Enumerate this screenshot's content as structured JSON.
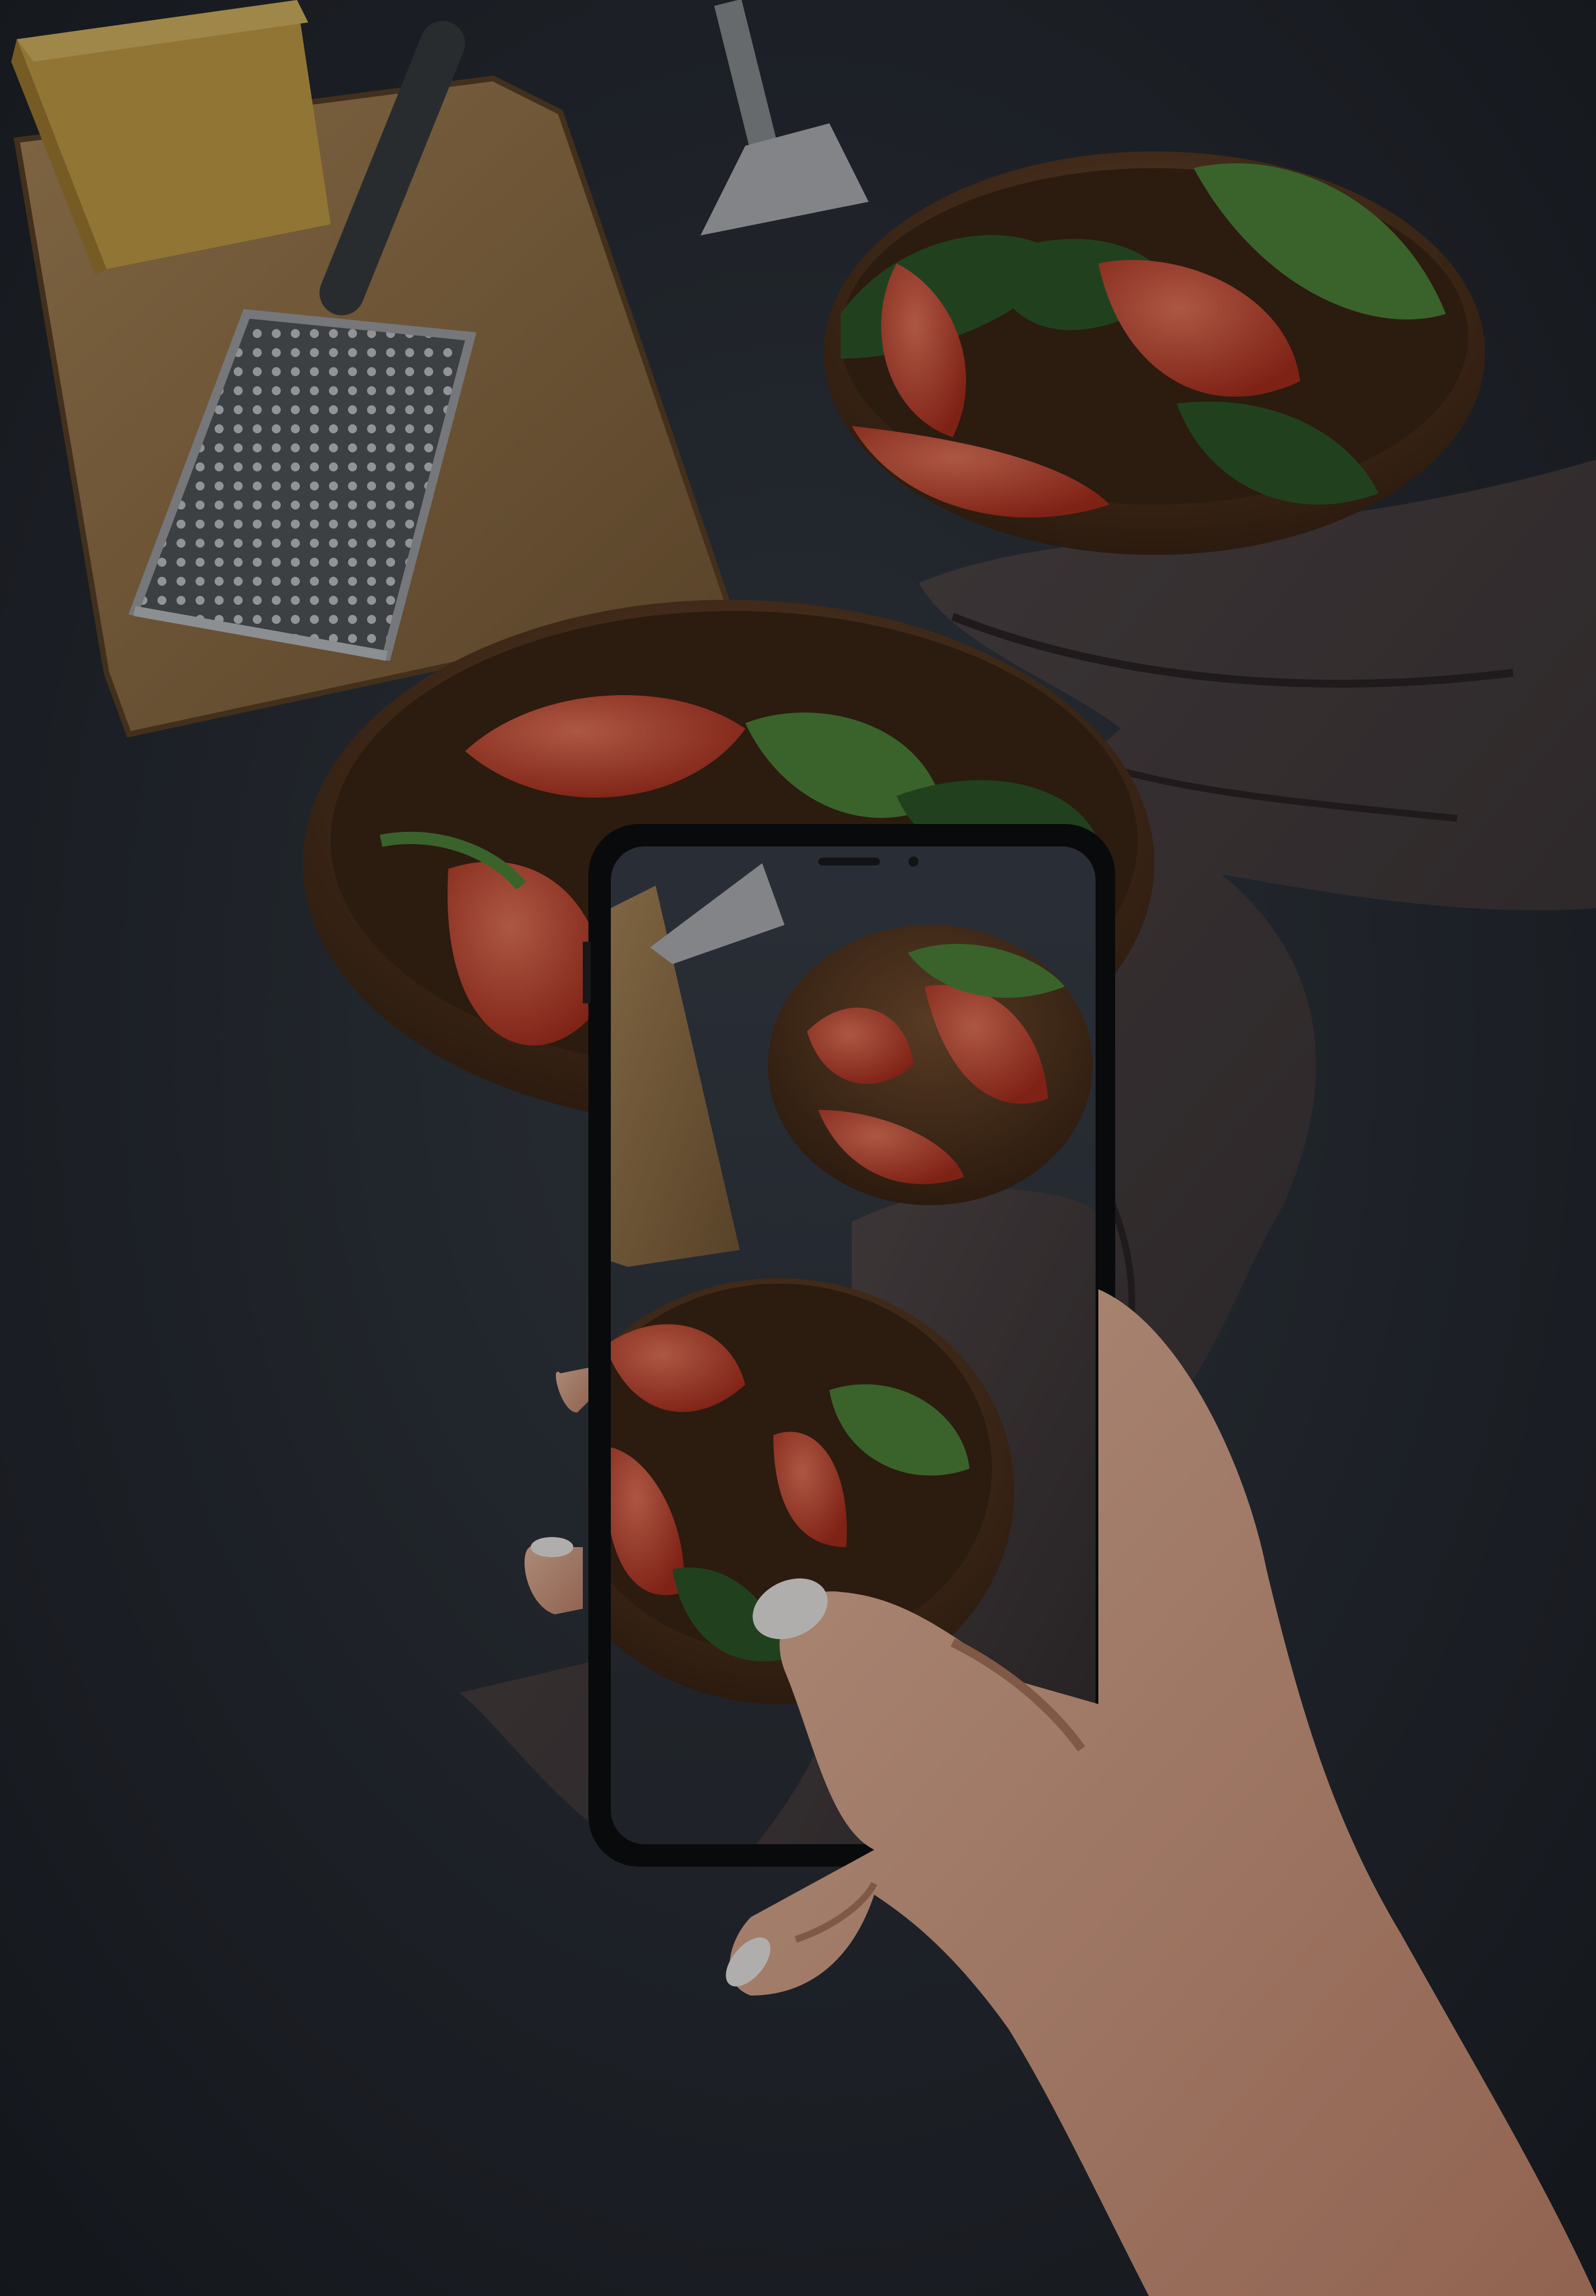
{
  "scene": {
    "palette": {
      "table": "#2f343d",
      "table_dark": "#1d2128",
      "board": "#8a6a44",
      "board_light": "#a98556",
      "cheese": "#c9a24a",
      "bowl": "#5a3a22",
      "bowl_rim": "#7a5232",
      "tomato": "#d0412c",
      "tomato_light": "#e8684c",
      "spinach": "#2f5a2a",
      "spinach_light": "#4f8a3c",
      "cloth": "#4a4244",
      "metal": "#9a9ea4",
      "phone": "#0d0e10",
      "skin": "#e7b49a",
      "skin_shadow": "#c98f76",
      "nail": "#f4f2ef"
    },
    "objects": [
      "cheese-block",
      "cutting-board",
      "cheese-grater",
      "fork",
      "salad-bowl-back",
      "salad-bowl-front",
      "linen-napkin",
      "smartphone",
      "hand"
    ]
  }
}
